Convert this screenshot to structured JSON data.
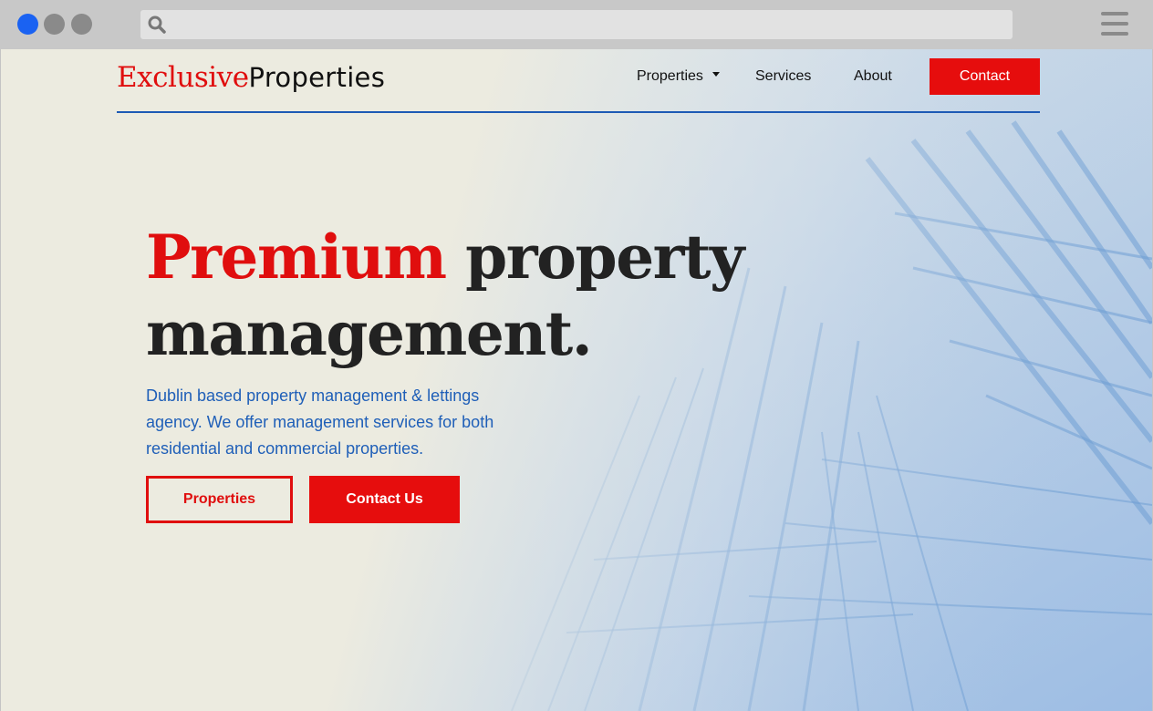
{
  "browser": {
    "icons": [
      "search-icon",
      "hamburger-menu-icon"
    ]
  },
  "nav": {
    "logo_part1": "Exclusive",
    "logo_part2": "Properties",
    "properties_label": "Properties",
    "services_label": "Services",
    "about_label": "About",
    "contact_label": "Contact"
  },
  "hero": {
    "headline_accent": "Premium",
    "headline_rest": " property management.",
    "lead": "Dublin based property management & lettings agency. We offer management services for both residential and commercial properties.",
    "primary_button": "Properties",
    "secondary_button": "Contact Us"
  },
  "colors": {
    "brand_red": "#e00e0e",
    "link_blue": "#1f5fb8",
    "background": "#ecebe0"
  }
}
